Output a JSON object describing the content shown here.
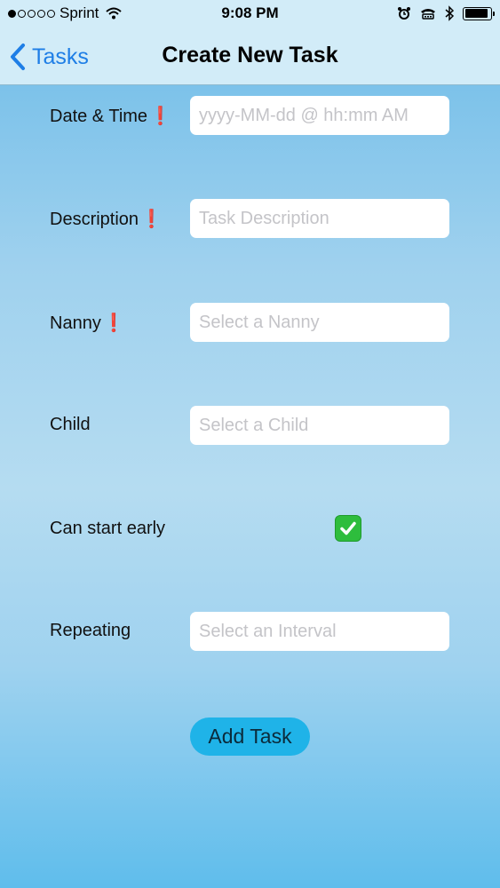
{
  "status_bar": {
    "carrier": "Sprint",
    "time": "9:08 PM",
    "signal_dots": [
      true,
      false,
      false,
      false,
      false
    ],
    "icons": [
      "wifi-icon",
      "alarm-icon",
      "tty-icon",
      "bluetooth-icon",
      "battery-icon"
    ],
    "battery_level": 0.9
  },
  "nav": {
    "back_label": "Tasks",
    "title": "Create New Task"
  },
  "form": {
    "date_time": {
      "label": "Date & Time",
      "placeholder": "yyyy-MM-dd @ hh:mm AM",
      "required_mark": "❗"
    },
    "description": {
      "label": "Description",
      "placeholder": "Task Description",
      "required_mark": "❗"
    },
    "nanny": {
      "label": "Nanny",
      "placeholder": "Select a Nanny",
      "required_mark": "❗"
    },
    "child": {
      "label": "Child",
      "placeholder": "Select a Child"
    },
    "can_start_early": {
      "label": "Can start early",
      "checked": true
    },
    "repeating": {
      "label": "Repeating",
      "placeholder": "Select an Interval"
    }
  },
  "add_button_label": "Add Task",
  "colors": {
    "accent": "#1e7ee6",
    "required": "#d0121b",
    "button": "#1fb3e8",
    "checkbox": "#2ebd3d"
  }
}
